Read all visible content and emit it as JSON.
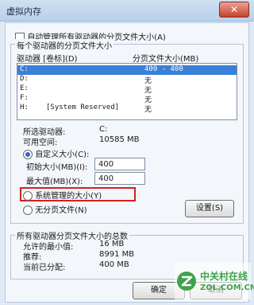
{
  "window": {
    "title": "虚拟内存",
    "close_glyph": "✕"
  },
  "auto_manage": {
    "label": "自动管理所有驱动器的分页文件大小(A)",
    "checked": false
  },
  "group1": {
    "title": "每个驱动器的分页文件大小",
    "col_drive": "驱动器 [卷标](D)",
    "col_size": "分页文件大小(MB)",
    "rows": [
      {
        "drive": "C:",
        "label": "",
        "size": "400 - 400"
      },
      {
        "drive": "D:",
        "label": "",
        "size": "无"
      },
      {
        "drive": "E:",
        "label": "",
        "size": "无"
      },
      {
        "drive": "F:",
        "label": "",
        "size": "无"
      },
      {
        "drive": "H:",
        "label": "[System Reserved]",
        "size": "无"
      }
    ],
    "selected_drive_label": "所选驱动器:",
    "selected_drive_value": "C:",
    "free_space_label": "可用空间:",
    "free_space_value": "10585 MB",
    "custom_size_label": "自定义大小(C):",
    "initial_size_label": "初始大小(MB)(I):",
    "initial_size_value": "400",
    "max_size_label": "最大值(MB)(X):",
    "max_size_value": "400",
    "system_managed_label": "系统管理的大小(Y)",
    "no_paging_label": "无分页文件(N)",
    "set_button": "设置(S)"
  },
  "group2": {
    "title": "所有驱动器分页文件大小的总数",
    "min_allowed_label": "允许的最小值:",
    "min_allowed_value": "16 MB",
    "recommended_label": "推荐:",
    "recommended_value": "8991 MB",
    "allocated_label": "当前已分配:",
    "allocated_value": "400 MB"
  },
  "buttons": {
    "ok": "确定",
    "cancel": "取消"
  },
  "watermark": {
    "cn": "中关村在线",
    "domain": "ZOL.COM.CN"
  },
  "colors": {
    "selection": "#3a7fd8",
    "highlight_box": "#d62020",
    "watermark": "#3ea44a"
  }
}
